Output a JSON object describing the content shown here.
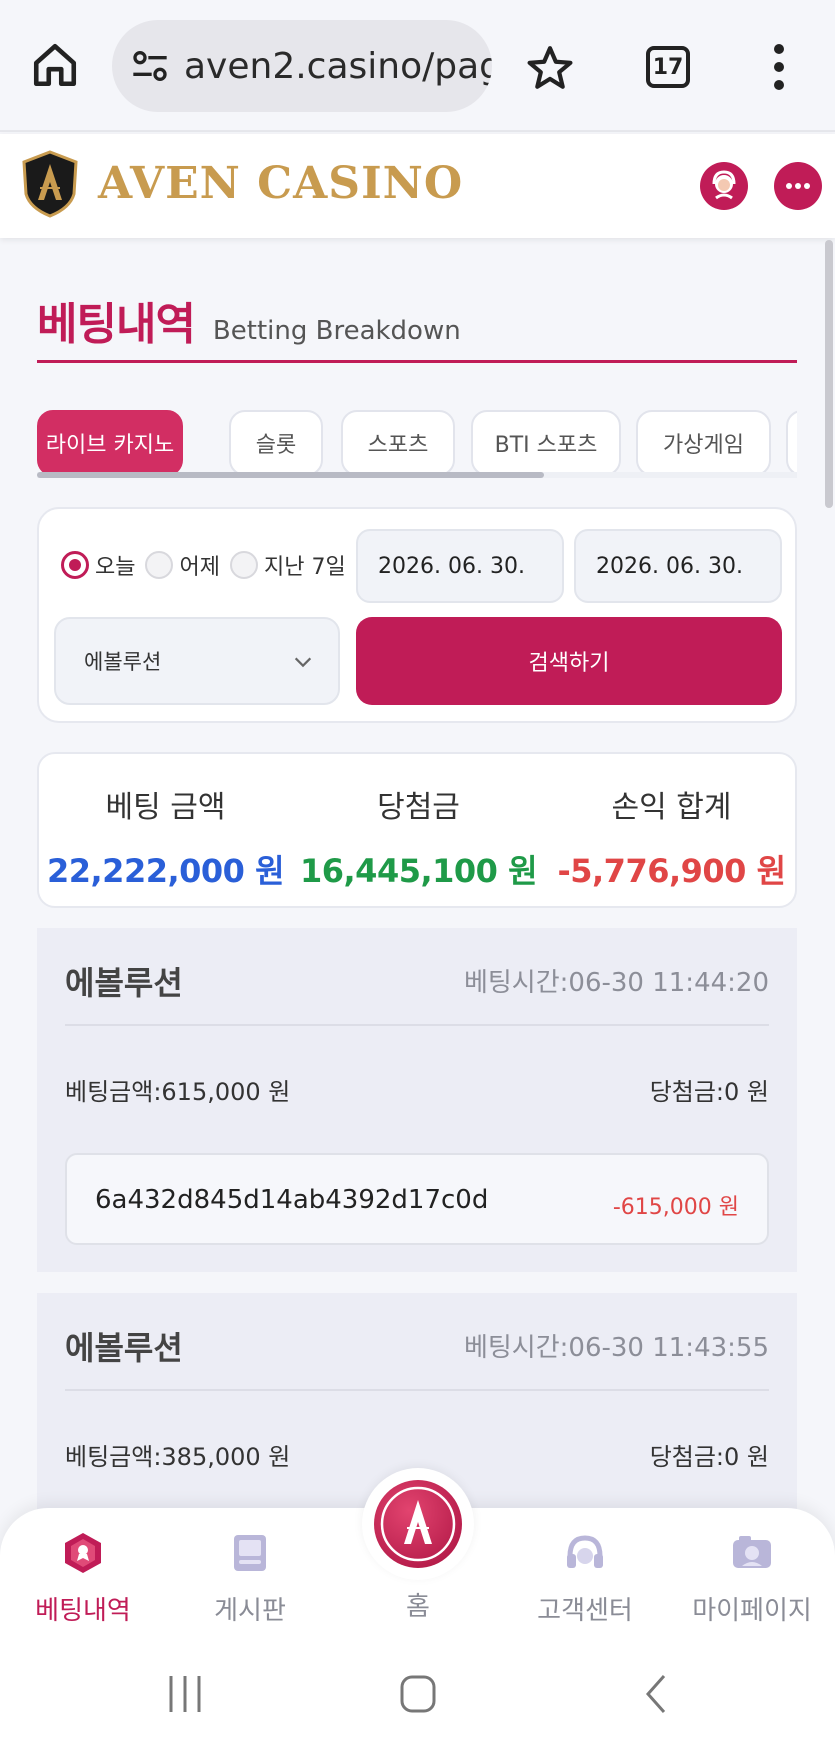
{
  "browser": {
    "url": "aven2.casino/pag",
    "tab_count": "17"
  },
  "site": {
    "logo_text": "AVEN CASINO"
  },
  "page": {
    "title_ko": "베팅내역",
    "title_en": "Betting Breakdown"
  },
  "tabs": [
    {
      "label": "라이브 카지노",
      "active": true
    },
    {
      "label": "슬롯",
      "active": false
    },
    {
      "label": "스포츠",
      "active": false
    },
    {
      "label": "BTI 스포츠",
      "active": false
    },
    {
      "label": "가상게임",
      "active": false
    }
  ],
  "filters": {
    "periods": [
      {
        "label": "오늘",
        "checked": true
      },
      {
        "label": "어제",
        "checked": false
      },
      {
        "label": "지난 7일",
        "checked": false
      }
    ],
    "date_from": "2026. 06. 30.",
    "date_to": "2026. 06. 30.",
    "provider": "에볼루션",
    "search_label": "검색하기"
  },
  "summary": {
    "bet_label": "베팅 금액",
    "bet_value": "22,222,000 원",
    "win_label": "당첨금",
    "win_value": "16,445,100 원",
    "pl_label": "손익 합계",
    "pl_value": "-5,776,900 원"
  },
  "records": [
    {
      "provider": "에볼루션",
      "time": "베팅시간:06-30 11:44:20",
      "bet": "베팅금액:615,000 원",
      "win": "당첨금:0 원",
      "id": "6a432d845d14ab4392d17c0d",
      "pl": "-615,000 원"
    },
    {
      "provider": "에볼루션",
      "time": "베팅시간:06-30 11:43:55",
      "bet": "베팅금액:385,000 원",
      "win": "당첨금:0 원"
    }
  ],
  "bottom_nav": [
    {
      "label": "베팅내역",
      "active": true
    },
    {
      "label": "게시판",
      "active": false
    },
    {
      "label": "홈",
      "active": false
    },
    {
      "label": "고객센터",
      "active": false
    },
    {
      "label": "마이페이지",
      "active": false
    }
  ],
  "colors": {
    "brand": "#c01c57",
    "gold": "#c89b4f",
    "bet_blue": "#2a5fd8",
    "win_green": "#1f9a48",
    "loss_red": "#e04646"
  },
  "icons": [
    "home-icon",
    "site-settings-icon",
    "star-icon",
    "tabs-icon",
    "more-vert-icon",
    "support-agent-icon",
    "chat-icon",
    "chevron-down-icon",
    "betting-history-icon",
    "board-icon",
    "home-logo-icon",
    "headset-icon",
    "mypage-icon",
    "recent-apps-icon",
    "home-system-icon",
    "back-icon"
  ]
}
